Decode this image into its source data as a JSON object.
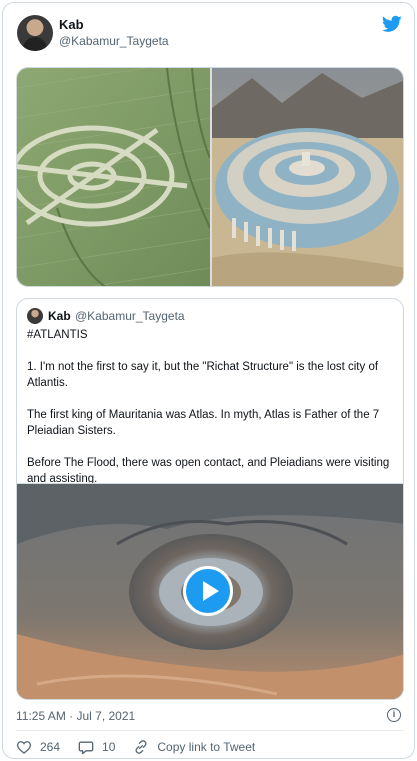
{
  "tweet": {
    "author_name": "Kab",
    "author_handle": "@Kabamur_Taygeta",
    "timestamp": "11:25 AM · Jul 7, 2021",
    "icons": [
      "twitter-bird-icon",
      "info-icon",
      "heart-icon",
      "reply-icon",
      "link-icon"
    ],
    "actions": {
      "likes": "264",
      "replies": "10",
      "copy_link": "Copy link to Tweet"
    }
  },
  "quoted": {
    "author_name": "Kab",
    "author_handle": "@Kabamur_Taygeta",
    "hashtag": "#ATLANTIS",
    "paragraph1": "1. I'm not the first to say it, but the \"Richat Structure\" is the lost city of Atlantis.",
    "paragraph2": "The first king of Mauritania was Atlas. In myth, Atlas is Father of the 7 Pleiadian Sisters.",
    "paragraph3": "Before The Flood, there was open contact, and Pleiadians were visiting and assisting."
  },
  "colors": {
    "accent": "#1d9bf0",
    "muted_text": "#536471",
    "border": "#cfd9de"
  }
}
